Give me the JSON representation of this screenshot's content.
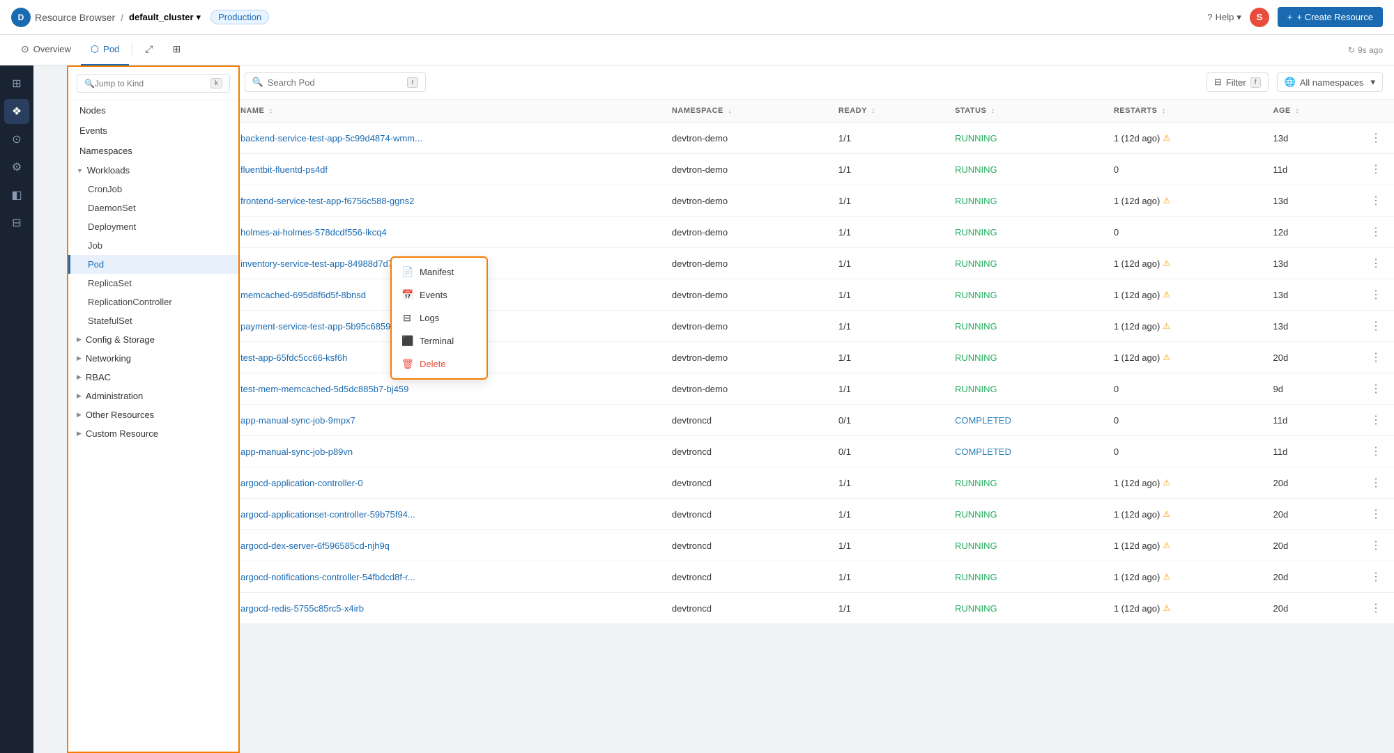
{
  "topbar": {
    "logo_text": "D",
    "app_name": "Resource Browser",
    "separator": "/",
    "cluster_name": "default_cluster",
    "env_label": "Production",
    "help_label": "Help",
    "avatar_label": "S",
    "create_label": "+ Create Resource",
    "refresh_label": "9s ago"
  },
  "tabs": [
    {
      "id": "overview",
      "label": "Overview",
      "icon": "⊙",
      "active": false
    },
    {
      "id": "pod",
      "label": "Pod",
      "icon": "⬡",
      "active": true
    }
  ],
  "sidebar": {
    "search_placeholder": "Jump to Kind",
    "search_kbd": "k",
    "items": [
      {
        "id": "nodes",
        "label": "Nodes",
        "level": 0
      },
      {
        "id": "events",
        "label": "Events",
        "level": 0
      },
      {
        "id": "namespaces",
        "label": "Namespaces",
        "level": 0
      }
    ],
    "groups": [
      {
        "id": "workloads",
        "label": "Workloads",
        "expanded": true,
        "children": [
          {
            "id": "cronjob",
            "label": "CronJob",
            "active": false
          },
          {
            "id": "daemonset",
            "label": "DaemonSet",
            "active": false
          },
          {
            "id": "deployment",
            "label": "Deployment",
            "active": false
          },
          {
            "id": "job",
            "label": "Job",
            "active": false
          },
          {
            "id": "pod",
            "label": "Pod",
            "active": true
          },
          {
            "id": "replicaset",
            "label": "ReplicaSet",
            "active": false
          },
          {
            "id": "replicationcontroller",
            "label": "ReplicationController",
            "active": false
          },
          {
            "id": "statefulset",
            "label": "StatefulSet",
            "active": false
          }
        ]
      },
      {
        "id": "config-storage",
        "label": "Config & Storage",
        "expanded": false
      },
      {
        "id": "networking",
        "label": "Networking",
        "expanded": false
      },
      {
        "id": "rbac",
        "label": "RBAC",
        "expanded": false
      },
      {
        "id": "administration",
        "label": "Administration",
        "expanded": false
      },
      {
        "id": "other-resources",
        "label": "Other Resources",
        "expanded": false
      },
      {
        "id": "custom-resource",
        "label": "Custom Resource",
        "expanded": false
      }
    ]
  },
  "main": {
    "search_placeholder": "Search Pod",
    "search_kbd": "r",
    "filter_label": "Filter",
    "filter_kbd": "f",
    "namespace_label": "All namespaces",
    "columns": [
      {
        "id": "name",
        "label": "NAME",
        "sortable": true
      },
      {
        "id": "namespace",
        "label": "NAMESPACE",
        "sortable": true
      },
      {
        "id": "ready",
        "label": "READY",
        "sortable": true
      },
      {
        "id": "status",
        "label": "STATUS",
        "sortable": true
      },
      {
        "id": "restarts",
        "label": "RESTARTS",
        "sortable": true
      },
      {
        "id": "age",
        "label": "AGE",
        "sortable": true
      }
    ],
    "rows": [
      {
        "name": "backend-service-test-app-5c99d4874-wmm...",
        "namespace": "devtron-demo",
        "ready": "1/1",
        "status": "RUNNING",
        "restarts": "1 (12d ago)",
        "restart_warn": true,
        "age": "13d"
      },
      {
        "name": "fluentbit-fluentd-ps4df",
        "namespace": "devtron-demo",
        "ready": "1/1",
        "status": "RUNNING",
        "restarts": "0",
        "restart_warn": false,
        "age": "11d"
      },
      {
        "name": "frontend-service-test-app-f6756c588-ggns2",
        "namespace": "devtron-demo",
        "ready": "1/1",
        "status": "RUNNING",
        "restarts": "1 (12d ago)",
        "restart_warn": true,
        "age": "13d"
      },
      {
        "name": "holmes-ai-holmes-578dcdf556-lkcq4",
        "namespace": "devtron-demo",
        "ready": "1/1",
        "status": "RUNNING",
        "restarts": "0",
        "restart_warn": false,
        "age": "12d"
      },
      {
        "name": "inventory-service-test-app-84988d7d7d-hh...",
        "namespace": "devtron-demo",
        "ready": "1/1",
        "status": "RUNNING",
        "restarts": "1 (12d ago)",
        "restart_warn": true,
        "age": "13d",
        "menu_open": true
      },
      {
        "name": "memcached-695d8f6d5f-8bnsd",
        "namespace": "devtron-demo",
        "ready": "1/1",
        "status": "RUNNING",
        "restarts": "1 (12d ago)",
        "restart_warn": true,
        "age": "13d"
      },
      {
        "name": "payment-service-test-app-5b95c6859b-4wx...",
        "namespace": "devtron-demo",
        "ready": "1/1",
        "status": "RUNNING",
        "restarts": "1 (12d ago)",
        "restart_warn": true,
        "age": "13d"
      },
      {
        "name": "test-app-65fdc5cc66-ksf6h",
        "namespace": "devtron-demo",
        "ready": "1/1",
        "status": "RUNNING",
        "restarts": "1 (12d ago)",
        "restart_warn": true,
        "age": "20d"
      },
      {
        "name": "test-mem-memcached-5d5dc885b7-bj459",
        "namespace": "devtron-demo",
        "ready": "1/1",
        "status": "RUNNING",
        "restarts": "0",
        "restart_warn": false,
        "age": "9d"
      },
      {
        "name": "app-manual-sync-job-9mpx7",
        "namespace": "devtroncd",
        "ready": "0/1",
        "status": "COMPLETED",
        "restarts": "0",
        "restart_warn": false,
        "age": "11d"
      },
      {
        "name": "app-manual-sync-job-p89vn",
        "namespace": "devtroncd",
        "ready": "0/1",
        "status": "COMPLETED",
        "restarts": "0",
        "restart_warn": false,
        "age": "11d"
      },
      {
        "name": "argocd-application-controller-0",
        "namespace": "devtroncd",
        "ready": "1/1",
        "status": "RUNNING",
        "restarts": "1 (12d ago)",
        "restart_warn": true,
        "age": "20d"
      },
      {
        "name": "argocd-applicationset-controller-59b75f94...",
        "namespace": "devtroncd",
        "ready": "1/1",
        "status": "RUNNING",
        "restarts": "1 (12d ago)",
        "restart_warn": true,
        "age": "20d"
      },
      {
        "name": "argocd-dex-server-6f596585cd-njh9q",
        "namespace": "devtroncd",
        "ready": "1/1",
        "status": "RUNNING",
        "restarts": "1 (12d ago)",
        "restart_warn": true,
        "age": "20d"
      },
      {
        "name": "argocd-notifications-controller-54fbdcd8f-r...",
        "namespace": "devtroncd",
        "ready": "1/1",
        "status": "RUNNING",
        "restarts": "1 (12d ago)",
        "restart_warn": true,
        "age": "20d"
      },
      {
        "name": "argocd-redis-5755c85rc5-x4irb",
        "namespace": "devtroncd",
        "ready": "1/1",
        "status": "RUNNING",
        "restarts": "1 (12d ago)",
        "restart_warn": true,
        "age": "20d"
      }
    ]
  },
  "context_menu": {
    "items": [
      {
        "id": "manifest",
        "label": "Manifest",
        "icon": "📄"
      },
      {
        "id": "events",
        "label": "Events",
        "icon": "📅"
      },
      {
        "id": "logs",
        "label": "Logs",
        "icon": "⊟"
      },
      {
        "id": "terminal",
        "label": "Terminal",
        "icon": "⬛"
      },
      {
        "id": "delete",
        "label": "Delete",
        "icon": "🗑",
        "danger": true
      }
    ]
  },
  "rail_icons": [
    {
      "id": "home",
      "symbol": "⊞",
      "active": false
    },
    {
      "id": "resource",
      "symbol": "❖",
      "active": true
    },
    {
      "id": "apps",
      "symbol": "⊙",
      "active": false
    },
    {
      "id": "settings",
      "symbol": "⚙",
      "active": false
    },
    {
      "id": "layers",
      "symbol": "◧",
      "active": false
    },
    {
      "id": "stack",
      "symbol": "⊟",
      "active": false
    }
  ]
}
